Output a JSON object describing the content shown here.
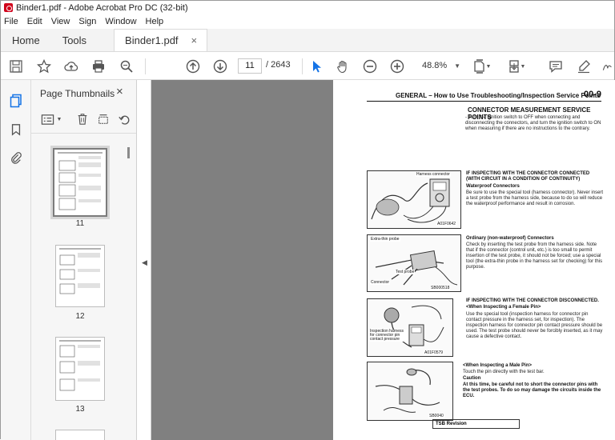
{
  "window": {
    "title": "Binder1.pdf - Adobe Acrobat Pro DC (32-bit)"
  },
  "menu": [
    "File",
    "Edit",
    "View",
    "Sign",
    "Window",
    "Help"
  ],
  "tabs": {
    "home": "Home",
    "tools": "Tools",
    "document": "Binder1.pdf",
    "close": "×"
  },
  "toolbar": {
    "current_page": "11",
    "page_count": "/ 2643",
    "zoom": "48.8%",
    "icons": [
      "save-icon",
      "bookmark-star-icon",
      "cloud-upload-icon",
      "print-icon",
      "find-icon",
      "previous-page-icon",
      "next-page-icon",
      "select-cursor-icon",
      "hand-tool-icon",
      "zoom-out-icon",
      "zoom-in-icon",
      "page-fit-icon",
      "scroll-mode-icon",
      "comment-icon",
      "highlight-icon",
      "sign-icon"
    ]
  },
  "thumbnails_panel": {
    "title": "Page Thumbnails",
    "close": "×",
    "pages": [
      {
        "label": "11",
        "selected": true
      },
      {
        "label": "12",
        "selected": false
      },
      {
        "label": "13",
        "selected": false
      }
    ]
  },
  "document": {
    "header_title": "GENERAL – How to Use Troubleshooting/Inspection Service Points",
    "page_number": "00-9",
    "heading1": "CONNECTOR MEASUREMENT SERVICE POINTS",
    "para1": "- Turn the ignition switch to OFF when connecting and disconnecting the connectors, and turn the ignition switch to ON when measuring if there are no instructions to the contrary.",
    "heading2": "IF INSPECTING WITH THE CONNECTOR CONNECTED (WITH CIRCUIT IN A CONDITION OF CONTINUITY)",
    "sub_waterproof": "Waterproof Connectors",
    "para_waterproof": "Be sure to use the special tool (harness connector). Never insert a test probe from the harness side, because to do so will reduce the waterproof performance and result in corrosion.",
    "sub_ordinary": "Ordinary (non-waterproof) Connectors",
    "para_ordinary": "Check by inserting the test probe from the harness side. Note that if the connector (control unit, etc.) is too small to permit insertion of the test probe, it should not be forced; use a special tool (the extra-thin probe in the harness set for checking) for this purpose.",
    "heading3": "IF INSPECTING WITH THE CONNECTOR DISCONNECTED.",
    "sub_female": "<When Inspecting a Female Pin>",
    "para_female": "Use the special tool (inspection harness for connector pin contact pressure in the harness set, for inspection). The inspection harness for connector pin contact pressure should be used. The test probe should never be forcibly inserted, as it may cause a defective contact.",
    "sub_male": "<When Inspecting a Male Pin>",
    "para_male": "Touch the pin directly with the test bar.",
    "caution_label": "Caution",
    "para_caution": "At this time, be careful not to short the connector pins with the test probes. To do so may damage the circuits inside the ECU.",
    "fig1_label": "Harness connector",
    "fig1_code": "A01F0642",
    "fig2_label_a": "Extra-thin probe",
    "fig2_label_b": "Test probe",
    "fig2_label_c": "Connector",
    "fig2_code": "SB000518",
    "fig3_label": "Inspection harness for connector pin contact pressure",
    "fig3_code": "A01F0579",
    "fig4_code": "SB0040",
    "footer_box": "TSB Revision"
  },
  "colors": {
    "accent": "#1473e6",
    "pdf_red": "#d0021b",
    "page_bg": "#7d7d7d"
  }
}
